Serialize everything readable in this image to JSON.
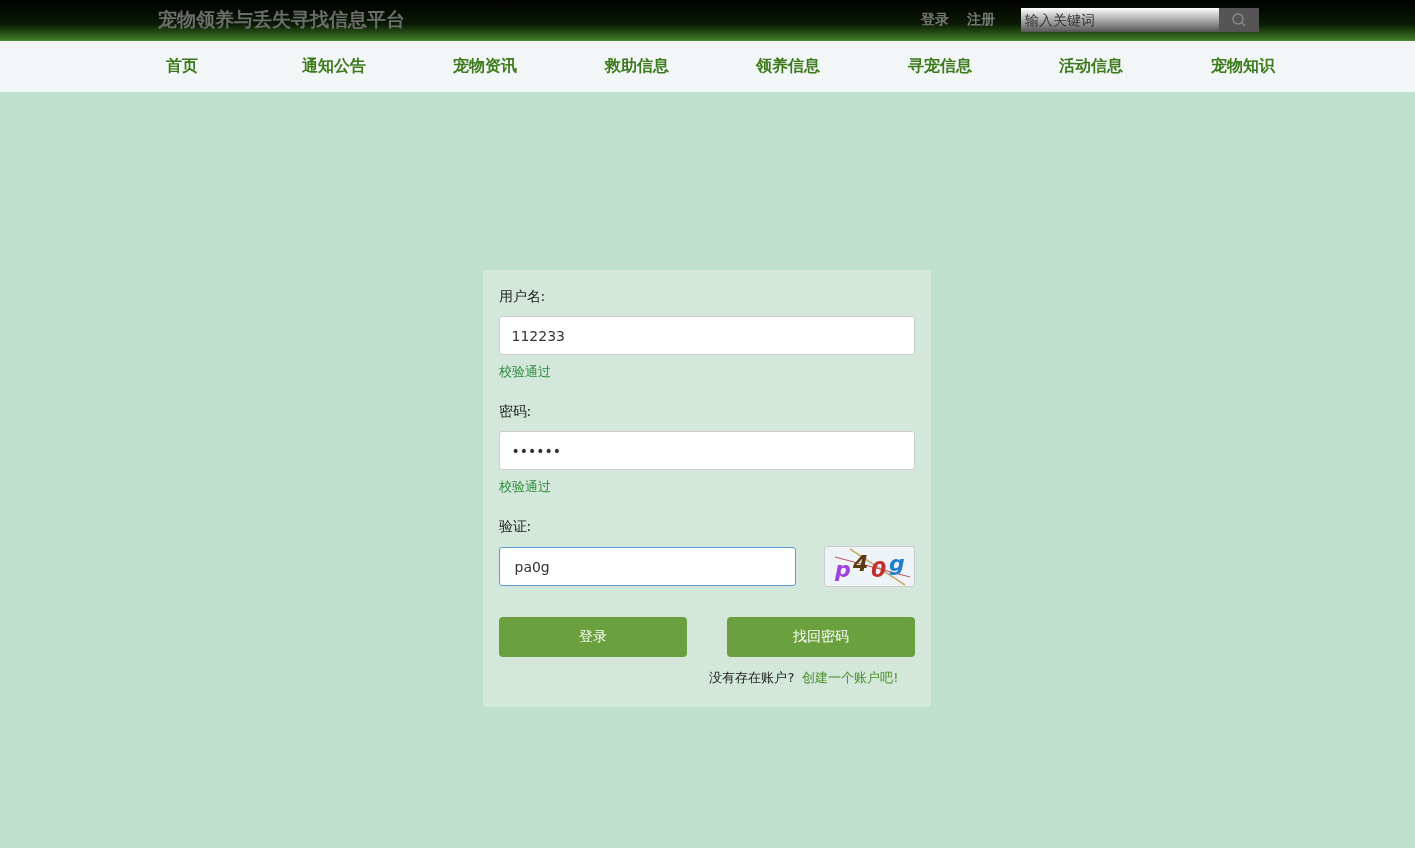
{
  "header": {
    "title": "宠物领养与丢失寻找信息平台",
    "links": [
      "登录",
      "注册"
    ],
    "search": {
      "placeholder": "输入关键词"
    }
  },
  "nav": [
    {
      "label": "首页"
    },
    {
      "label": "通知公告"
    },
    {
      "label": "宠物资讯"
    },
    {
      "label": "救助信息"
    },
    {
      "label": "领养信息"
    },
    {
      "label": "寻宠信息"
    },
    {
      "label": "活动信息"
    },
    {
      "label": "宠物知识"
    }
  ],
  "form": {
    "fields": [
      {
        "label": "用户名:",
        "value": "112233",
        "hint": "校验通过",
        "kind": "text",
        "focused": false
      },
      {
        "label": "密码:",
        "value": "••••••",
        "hint": "校验通过",
        "kind": "password",
        "focused": false
      },
      {
        "label": "验证:",
        "value": "pa0g",
        "kind": "captcha",
        "captcha": "p40g",
        "focused": true
      }
    ],
    "buttons": [
      "登录",
      "找回密码"
    ],
    "footer": {
      "text": "没有存在账户?",
      "link": "创建一个账户吧!"
    }
  }
}
